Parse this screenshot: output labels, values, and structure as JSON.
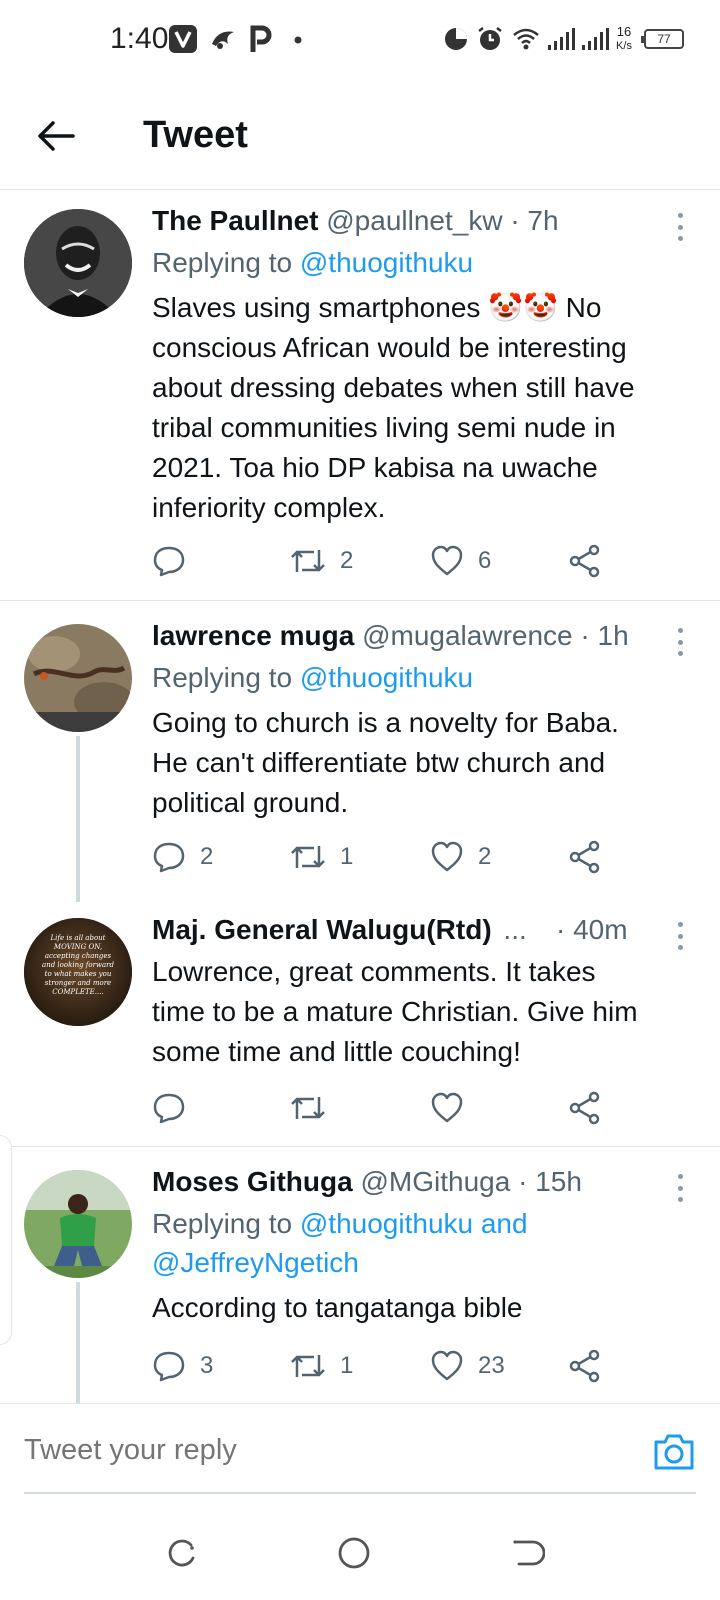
{
  "status_bar": {
    "time": "1:40",
    "network_speed_value": "16",
    "network_speed_unit": "K/s",
    "battery": "77",
    "icons": [
      "v-app-icon",
      "bird-icon",
      "p-app-icon",
      "dot-icon",
      "data-saver-icon",
      "alarm-icon",
      "wifi-icon",
      "signal-icon",
      "signal-icon",
      "battery-icon"
    ]
  },
  "header": {
    "title": "Tweet"
  },
  "tweets": [
    {
      "name": "The Paullnet",
      "handle": "@paullnet_kw · 7h",
      "replying_prefix": "Replying to ",
      "replying_to": "@thuogithuku",
      "text_lines": [
        "Slaves using smartphones 🤡🤡 No",
        "conscious African would be interesting",
        "about dressing debates when still have",
        "tribal communities living semi nude in",
        "2021. Toa hio DP kabisa na uwache",
        "inferiority complex."
      ],
      "reply_count": "",
      "retweet_count": "2",
      "like_count": "6"
    },
    {
      "name": "lawrence muga",
      "handle": "@mugalawrence · 1h",
      "replying_prefix": "Replying to ",
      "replying_to": "@thuogithuku",
      "text_lines": [
        "Going to church is a novelty for Baba.",
        "He can't differentiate btw  church and",
        "political ground."
      ],
      "reply_count": "2",
      "retweet_count": "1",
      "like_count": "2"
    },
    {
      "name": "Maj. General Walugu(Rtd)",
      "ellipsis": "...",
      "handle": "· 40m",
      "avatar_text": "Life is all about MOVING ON, accepting changes and looking forward to what makes you stronger and more COMPLETE....",
      "text_lines": [
        "Lowrence, great comments. It takes",
        "time to be a mature Christian. Give him",
        "some time and little couching!"
      ],
      "reply_count": "",
      "retweet_count": "",
      "like_count": ""
    },
    {
      "name": "Moses Githuga",
      "handle": "@MGithuga · 15h",
      "replying_prefix": "Replying to ",
      "replying_to": "@thuogithuku and",
      "replying_to_2": "@JeffreyNgetich",
      "text_lines": [
        "According to tangatanga bible"
      ],
      "reply_count": "3",
      "retweet_count": "1",
      "like_count": "23"
    }
  ],
  "reply_box": {
    "placeholder": "Tweet your reply"
  },
  "nav_bar": {
    "buttons": [
      "recents-icon",
      "home-circle-icon",
      "back-nav-icon"
    ]
  },
  "colors": {
    "accent": "#1d9bf0",
    "text_primary": "#0f1419",
    "text_secondary": "#536471",
    "divider": "#e1e5e8"
  }
}
